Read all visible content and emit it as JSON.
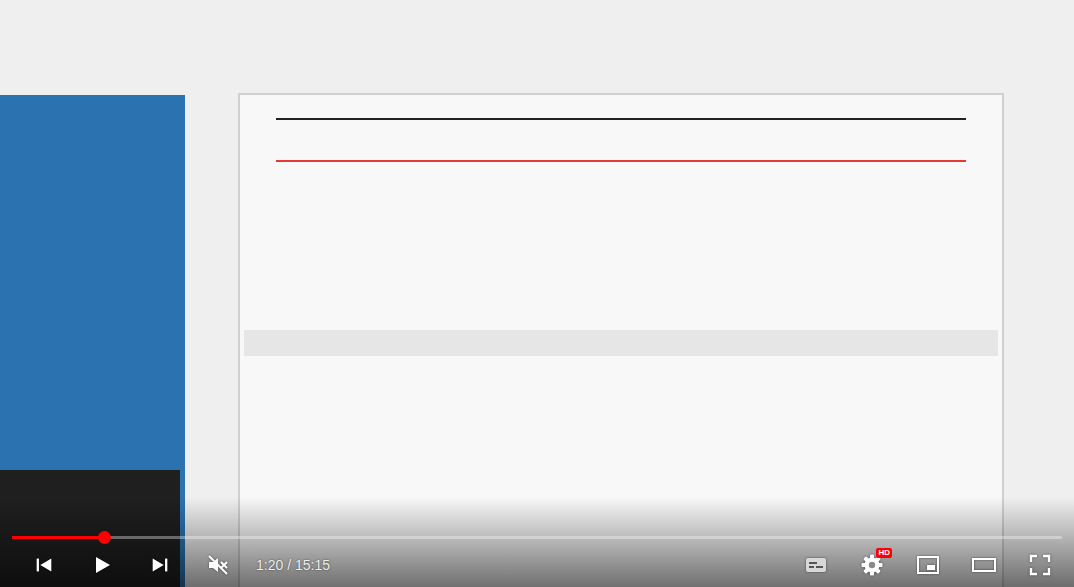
{
  "video": {
    "paused": true
  },
  "progress": {
    "level": 0.088
  },
  "volume": {
    "muted": true
  },
  "time": "1:20 / 15:15",
  "subtitles": {
    "on": false
  },
  "settings": {
    "badge": "HD"
  }
}
